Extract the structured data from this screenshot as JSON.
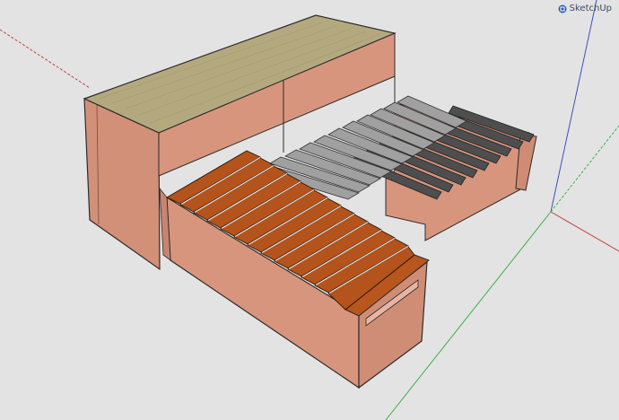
{
  "app": {
    "brand": "SketchUp",
    "brand_icon": "sketchup-logo-icon"
  },
  "scene": {
    "model": "bed-frame-with-storage-bench",
    "colors": {
      "background": "#e3e3e3",
      "axis_red": "#c4413b",
      "axis_green": "#3cb043",
      "axis_blue": "#3e4fc2",
      "panel_face": "#d8957d",
      "panel_side": "#cf8b73",
      "top_wood": "#b4a97e",
      "slat_brown": "#b4531b",
      "slat_gray": "#9a9a9a",
      "slat_dark": "#4e4e4e",
      "edge": "#2c2c2c"
    }
  }
}
